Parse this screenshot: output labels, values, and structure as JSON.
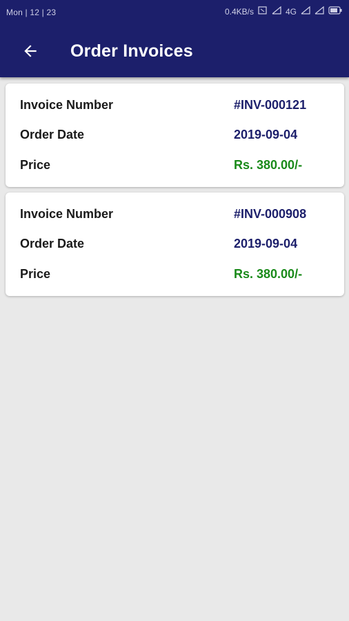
{
  "status_bar": {
    "time": "Mon | 12 | 23",
    "speed": "0.4KB/s",
    "network": "4G",
    "icons": [
      "sim-icon",
      "signal-icon",
      "signal-icon",
      "battery-icon"
    ]
  },
  "toolbar": {
    "title": "Order Invoices",
    "back_icon": "arrow-left-icon"
  },
  "colors": {
    "header": "#1c1f6b",
    "value_text": "#1c1f6b",
    "price_text": "#1a8a1a",
    "background": "#e9e9e9"
  },
  "invoices": [
    {
      "invoice_number_label": "Invoice Number",
      "invoice_number": "#INV-000121",
      "order_date_label": "Order Date",
      "order_date": "2019-09-04",
      "price_label": "Price",
      "price": "Rs. 380.00/-"
    },
    {
      "invoice_number_label": "Invoice Number",
      "invoice_number": "#INV-000908",
      "order_date_label": "Order Date",
      "order_date": "2019-09-04",
      "price_label": "Price",
      "price": "Rs. 380.00/-"
    }
  ]
}
